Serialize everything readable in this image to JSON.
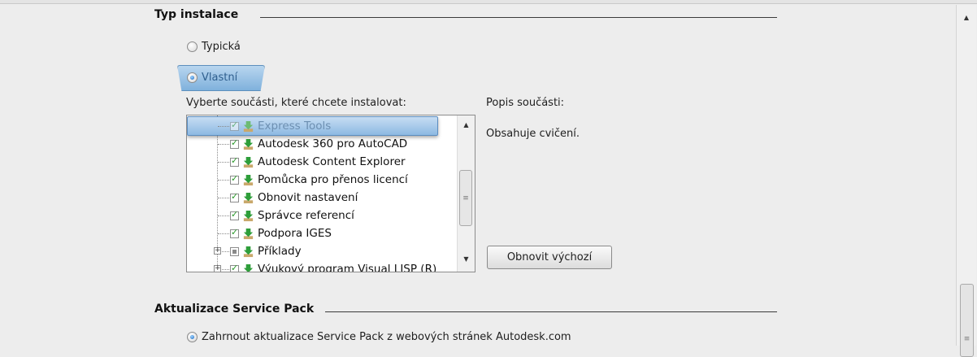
{
  "sections": {
    "install_type": {
      "title": "Typ instalace"
    },
    "service_pack": {
      "title": "Aktualizace Service Pack"
    }
  },
  "install_type": {
    "options": [
      {
        "label": "Typická",
        "checked": false
      },
      {
        "label": "Vlastní",
        "checked": true
      }
    ],
    "components_label": "Vyberte součásti, které chcete instalovat:",
    "description_label": "Popis součásti:",
    "description_text": "Obsahuje cvičení.",
    "restore_button": "Obnovit výchozí",
    "components": [
      {
        "label": "Express Tools",
        "state": "checked",
        "selected": true
      },
      {
        "label": "Autodesk 360 pro AutoCAD",
        "state": "checked"
      },
      {
        "label": "Autodesk Content Explorer",
        "state": "checked"
      },
      {
        "label": "Pomůcka pro přenos licencí",
        "state": "checked"
      },
      {
        "label": "Obnovit nastavení",
        "state": "checked"
      },
      {
        "label": "Správce referencí",
        "state": "checked"
      },
      {
        "label": "Podpora IGES",
        "state": "checked"
      },
      {
        "label": "Příklady",
        "state": "partial",
        "expandable": true
      },
      {
        "label": "Výukový program Visual LISP (R)",
        "state": "checked",
        "expandable": true
      }
    ]
  },
  "service_pack": {
    "option_label": "Zahrnout aktualizace Service Pack z webových stránek Autodesk.com",
    "checked": true
  },
  "colors": {
    "selection": "#8db9e2",
    "radio_dot": "#1565c0",
    "check_mark": "#2a9a2a",
    "download_icon": "#2e9e3a"
  }
}
